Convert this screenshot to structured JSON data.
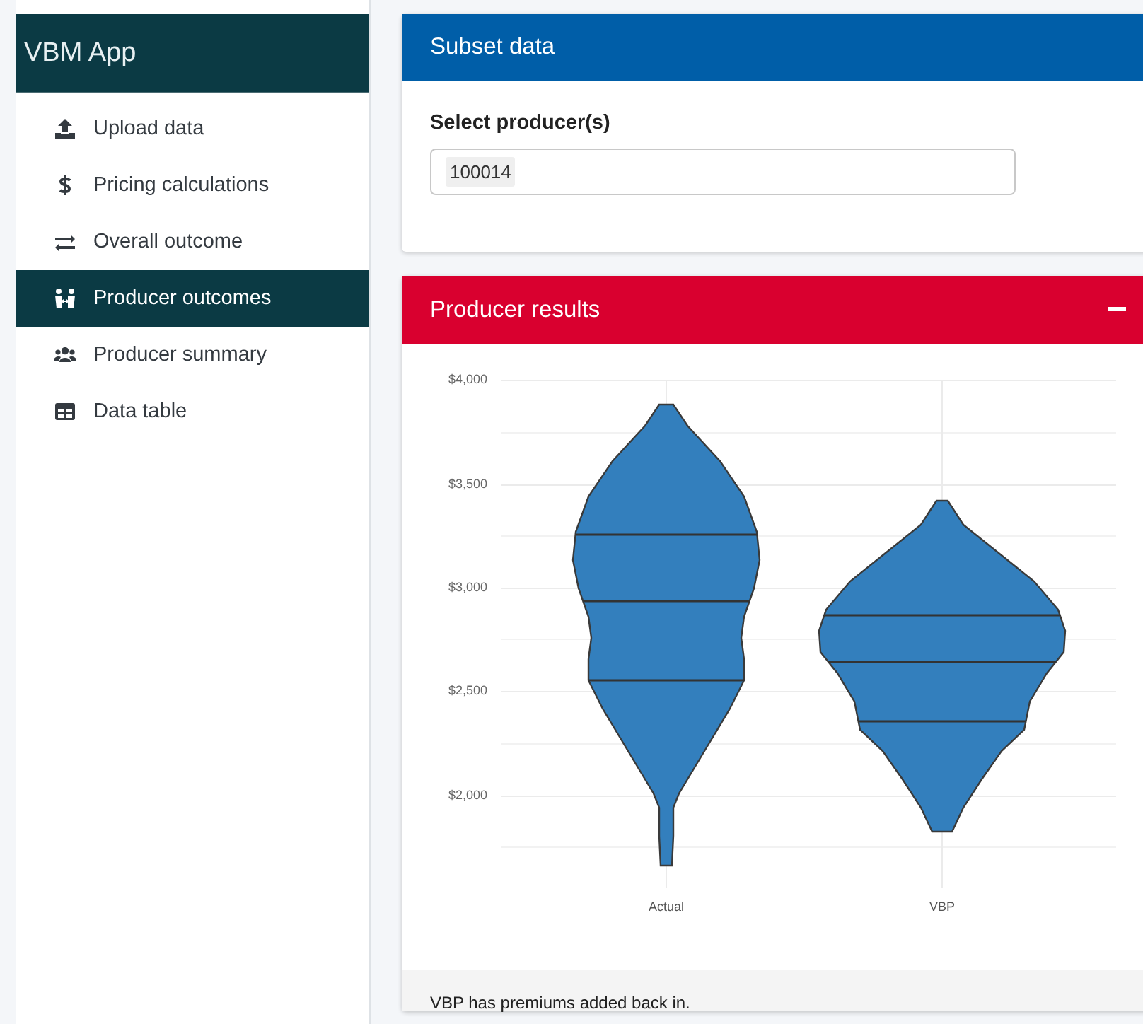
{
  "app": {
    "title": "VBM App"
  },
  "sidebar": {
    "items": [
      {
        "label": "Upload data",
        "selected": false
      },
      {
        "label": "Pricing calculations",
        "selected": false
      },
      {
        "label": "Overall outcome",
        "selected": false
      },
      {
        "label": "Producer outcomes",
        "selected": true
      },
      {
        "label": "Producer summary",
        "selected": false
      },
      {
        "label": "Data table",
        "selected": false
      }
    ]
  },
  "subset_card": {
    "title": "Subset data",
    "field_label": "Select producer(s)",
    "selected_values": [
      "100014"
    ]
  },
  "results_card": {
    "title": "Producer results",
    "y_tick_labels": [
      "$4,000",
      "$3,500",
      "$3,000",
      "$2,500",
      "$2,000"
    ],
    "categories": [
      "Actual",
      "VBP"
    ],
    "footer": "VBP has premiums added back in."
  }
}
